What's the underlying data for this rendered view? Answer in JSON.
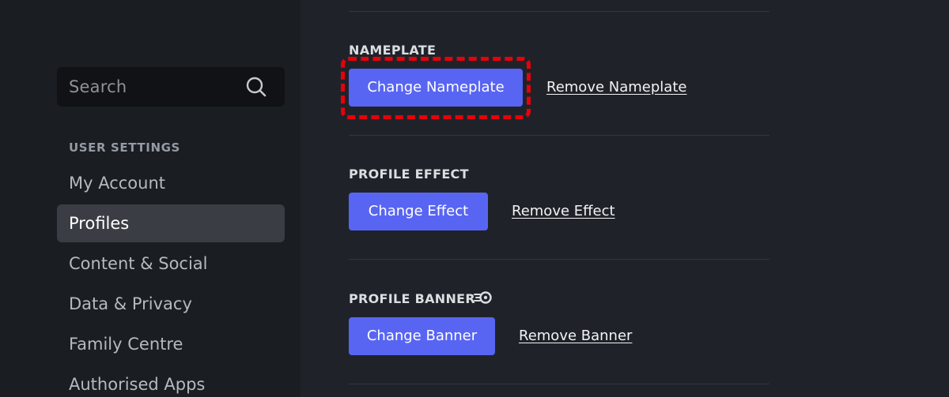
{
  "sidebar": {
    "search": {
      "placeholder": "Search",
      "icon": "search-icon"
    },
    "section_header": "USER SETTINGS",
    "items": [
      {
        "label": "My Account",
        "selected": false
      },
      {
        "label": "Profiles",
        "selected": true
      },
      {
        "label": "Content & Social",
        "selected": false
      },
      {
        "label": "Data & Privacy",
        "selected": false
      },
      {
        "label": "Family Centre",
        "selected": false
      },
      {
        "label": "Authorised Apps",
        "selected": false
      }
    ]
  },
  "main": {
    "nameplate": {
      "title": "NAMEPLATE",
      "change_label": "Change Nameplate",
      "remove_label": "Remove Nameplate",
      "highlighted": true
    },
    "profile_effect": {
      "title": "PROFILE EFFECT",
      "change_label": "Change Effect",
      "remove_label": "Remove Effect"
    },
    "profile_banner": {
      "title": "PROFILE BANNER",
      "badge_icon": "nitro-icon",
      "change_label": "Change Banner",
      "remove_label": "Remove Banner"
    }
  },
  "colors": {
    "accent": "#5865f2",
    "highlight": "#e8000b",
    "background": "#1f2329",
    "sidebar": "#1a1d21"
  }
}
